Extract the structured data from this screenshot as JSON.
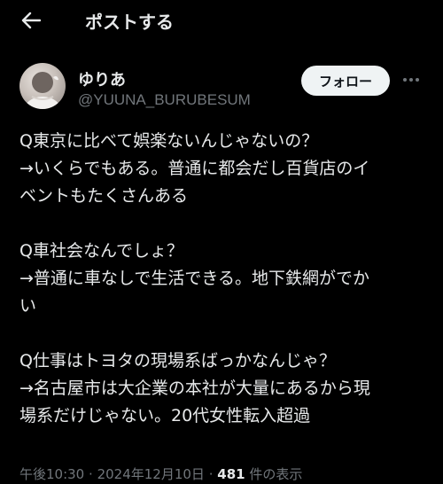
{
  "header": {
    "back_icon": "arrow-left-icon",
    "title": "ポストする"
  },
  "author": {
    "display_name": "ゆりあ",
    "handle": "@YUUNA_BURUBESUM",
    "follow_label": "フォロー",
    "more_icon": "more-horizontal-icon"
  },
  "post": {
    "paragraphs": [
      [
        "Q東京に比べて娯楽ないんじゃないの？",
        "→いくらでもある。普通に都会だし百貨店のイ",
        "ベントもたくさんある"
      ],
      [
        "Q車社会なんでしょ？",
        "→普通に車なしで生活できる。地下鉄網がでか",
        "い"
      ],
      [
        "Q仕事はトヨタの現場系ばっかなんじゃ？",
        "→名古屋市は大企業の本社が大量にあるから現",
        "場系だけじゃない。20代女性転入超過"
      ]
    ]
  },
  "meta": {
    "time": "午後10:30",
    "separator": "·",
    "date": "2024年12月10日",
    "views_count": "481",
    "views_label": "件の表示"
  },
  "colors": {
    "background": "#000000",
    "text": "#e7e9ea",
    "secondary_text": "#71767b",
    "follow_button_bg": "#eff3f4"
  }
}
